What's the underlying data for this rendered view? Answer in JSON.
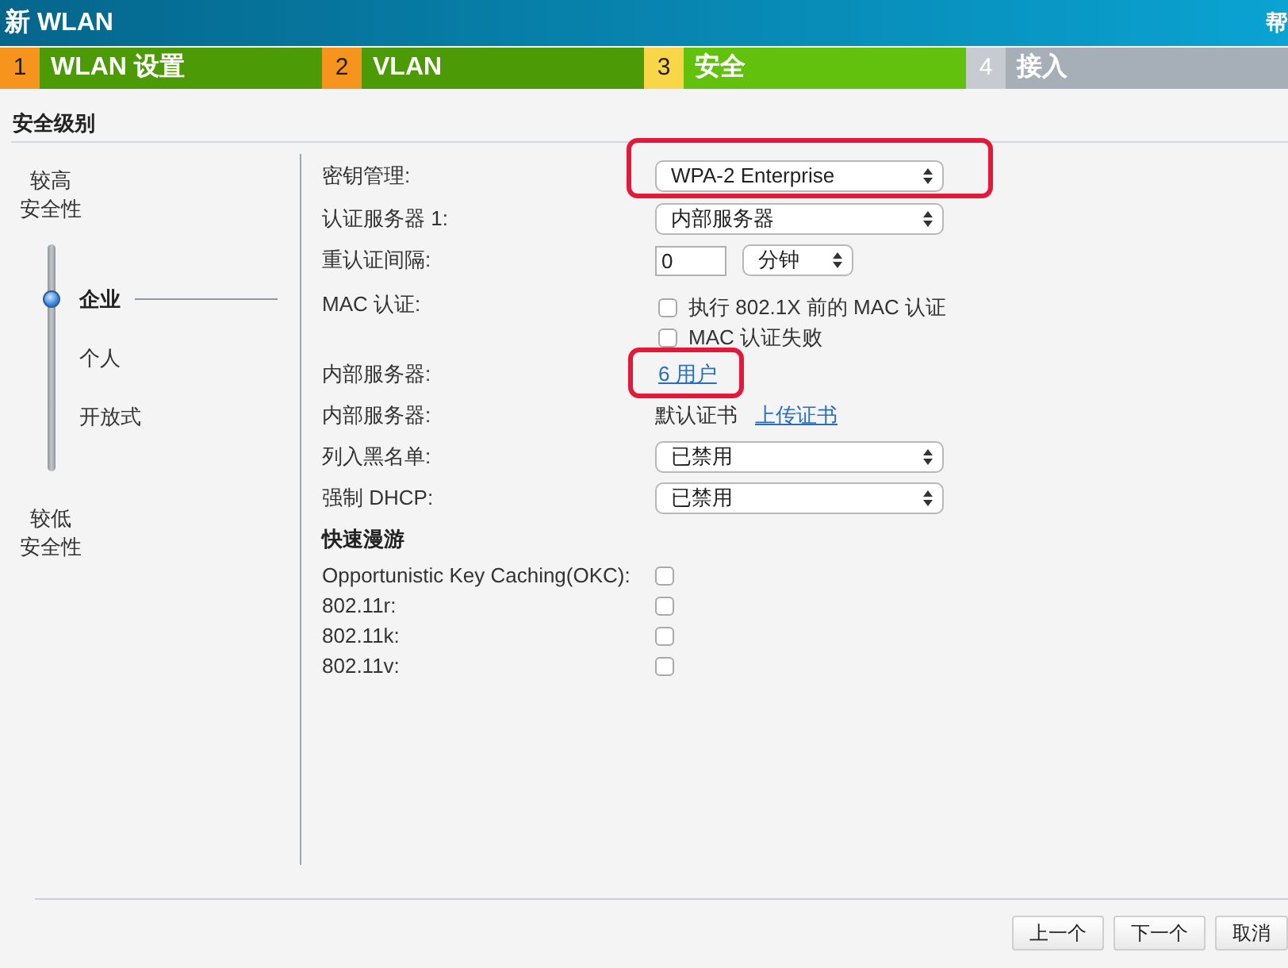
{
  "window": {
    "title": "新 WLAN",
    "corner_text": "帮"
  },
  "steps": [
    {
      "number": "1",
      "label": "WLAN 设置",
      "completed": true,
      "selected": false
    },
    {
      "number": "2",
      "label": "VLAN",
      "completed": true,
      "selected": false
    },
    {
      "number": "3",
      "label": "安全",
      "completed": false,
      "selected": true
    },
    {
      "number": "4",
      "label": "接入",
      "completed": false,
      "selected": false
    }
  ],
  "section_title": "安全级别",
  "security_level": {
    "high_label": [
      "较高",
      "安全性"
    ],
    "options": [
      {
        "label": "企业",
        "selected": true
      },
      {
        "label": "个人",
        "selected": false
      },
      {
        "label": "开放式",
        "selected": false
      }
    ],
    "low_label": [
      "较低",
      "安全性"
    ]
  },
  "form": {
    "rows": [
      {
        "kind": "select",
        "label": "密钥管理:",
        "value": "WPA-2 Enterprise",
        "highlighted": true
      },
      {
        "kind": "select",
        "label": "认证服务器 1:",
        "value": "内部服务器",
        "highlighted": false
      },
      {
        "kind": "interval",
        "label": "重认证间隔:",
        "value": "0",
        "unit": "分钟",
        "highlighted": false
      },
      {
        "kind": "checkboxes",
        "label": "MAC 认证:",
        "options": [
          {
            "label": "执行 802.1X 前的 MAC 认证",
            "checked": false
          },
          {
            "label": "MAC 认证失败",
            "checked": false
          }
        ],
        "highlighted": false
      },
      {
        "kind": "link",
        "label": "内部服务器:",
        "link": "6 用户",
        "highlighted": true
      },
      {
        "kind": "text_link",
        "label": "内部服务器:",
        "text": "默认证书",
        "link": "上传证书",
        "highlighted": false
      },
      {
        "kind": "select",
        "label": "列入黑名单:",
        "value": "已禁用",
        "highlighted": false
      },
      {
        "kind": "select",
        "label": "强制 DHCP:",
        "value": "已禁用",
        "highlighted": false
      }
    ]
  },
  "fast_roaming": {
    "title": "快速漫游",
    "items": [
      {
        "label": "Opportunistic Key Caching(OKC):",
        "checked": false
      },
      {
        "label": "802.11r:",
        "checked": false
      },
      {
        "label": "802.11k:",
        "checked": false
      },
      {
        "label": "802.11v:",
        "checked": false
      }
    ]
  },
  "buttons": [
    {
      "label": "上一个"
    },
    {
      "label": "下一个"
    },
    {
      "label": "取消"
    }
  ]
}
